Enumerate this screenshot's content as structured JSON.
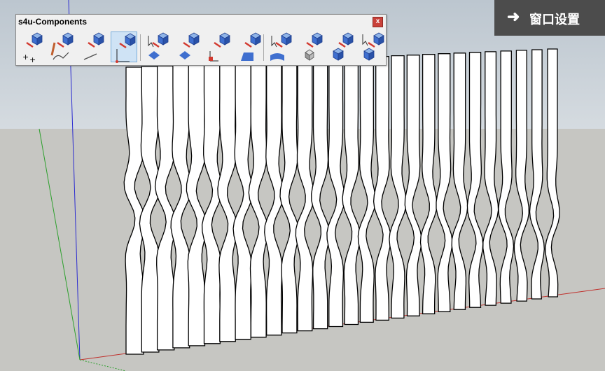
{
  "toolbar": {
    "title": "s4u-Components",
    "close_glyph": "x",
    "tool_groups": [
      {
        "name": "placement-tools",
        "tools": [
          "add-components-at-points-icon",
          "place-components-along-curve-icon",
          "place-components-along-line-icon",
          "move-components-along-axis-icon"
        ]
      },
      {
        "name": "face-tools",
        "tools": [
          "select-components-on-face-icon",
          "components-on-face-icon",
          "components-on-face-axis-icon",
          "components-on-surface-icon"
        ]
      },
      {
        "name": "edit-tools",
        "tools": [
          "select-components-on-curved-face-icon",
          "component-box-icon",
          "replace-components-icon",
          "select-similar-components-icon"
        ]
      }
    ],
    "active_tool": "move-components-along-axis-icon"
  },
  "overlay": {
    "arrow_glyph": "➜",
    "label": "窗口设置"
  },
  "scene": {
    "colors": {
      "sky": "#c8d0d7",
      "ground": "#c6c6c2",
      "fin_fill": "#ffffff",
      "fin_edge": "#000000",
      "axis_red": "#c0302c",
      "axis_green": "#2da02d",
      "axis_blue": "#2b2bd0"
    },
    "fin_count": 28
  }
}
